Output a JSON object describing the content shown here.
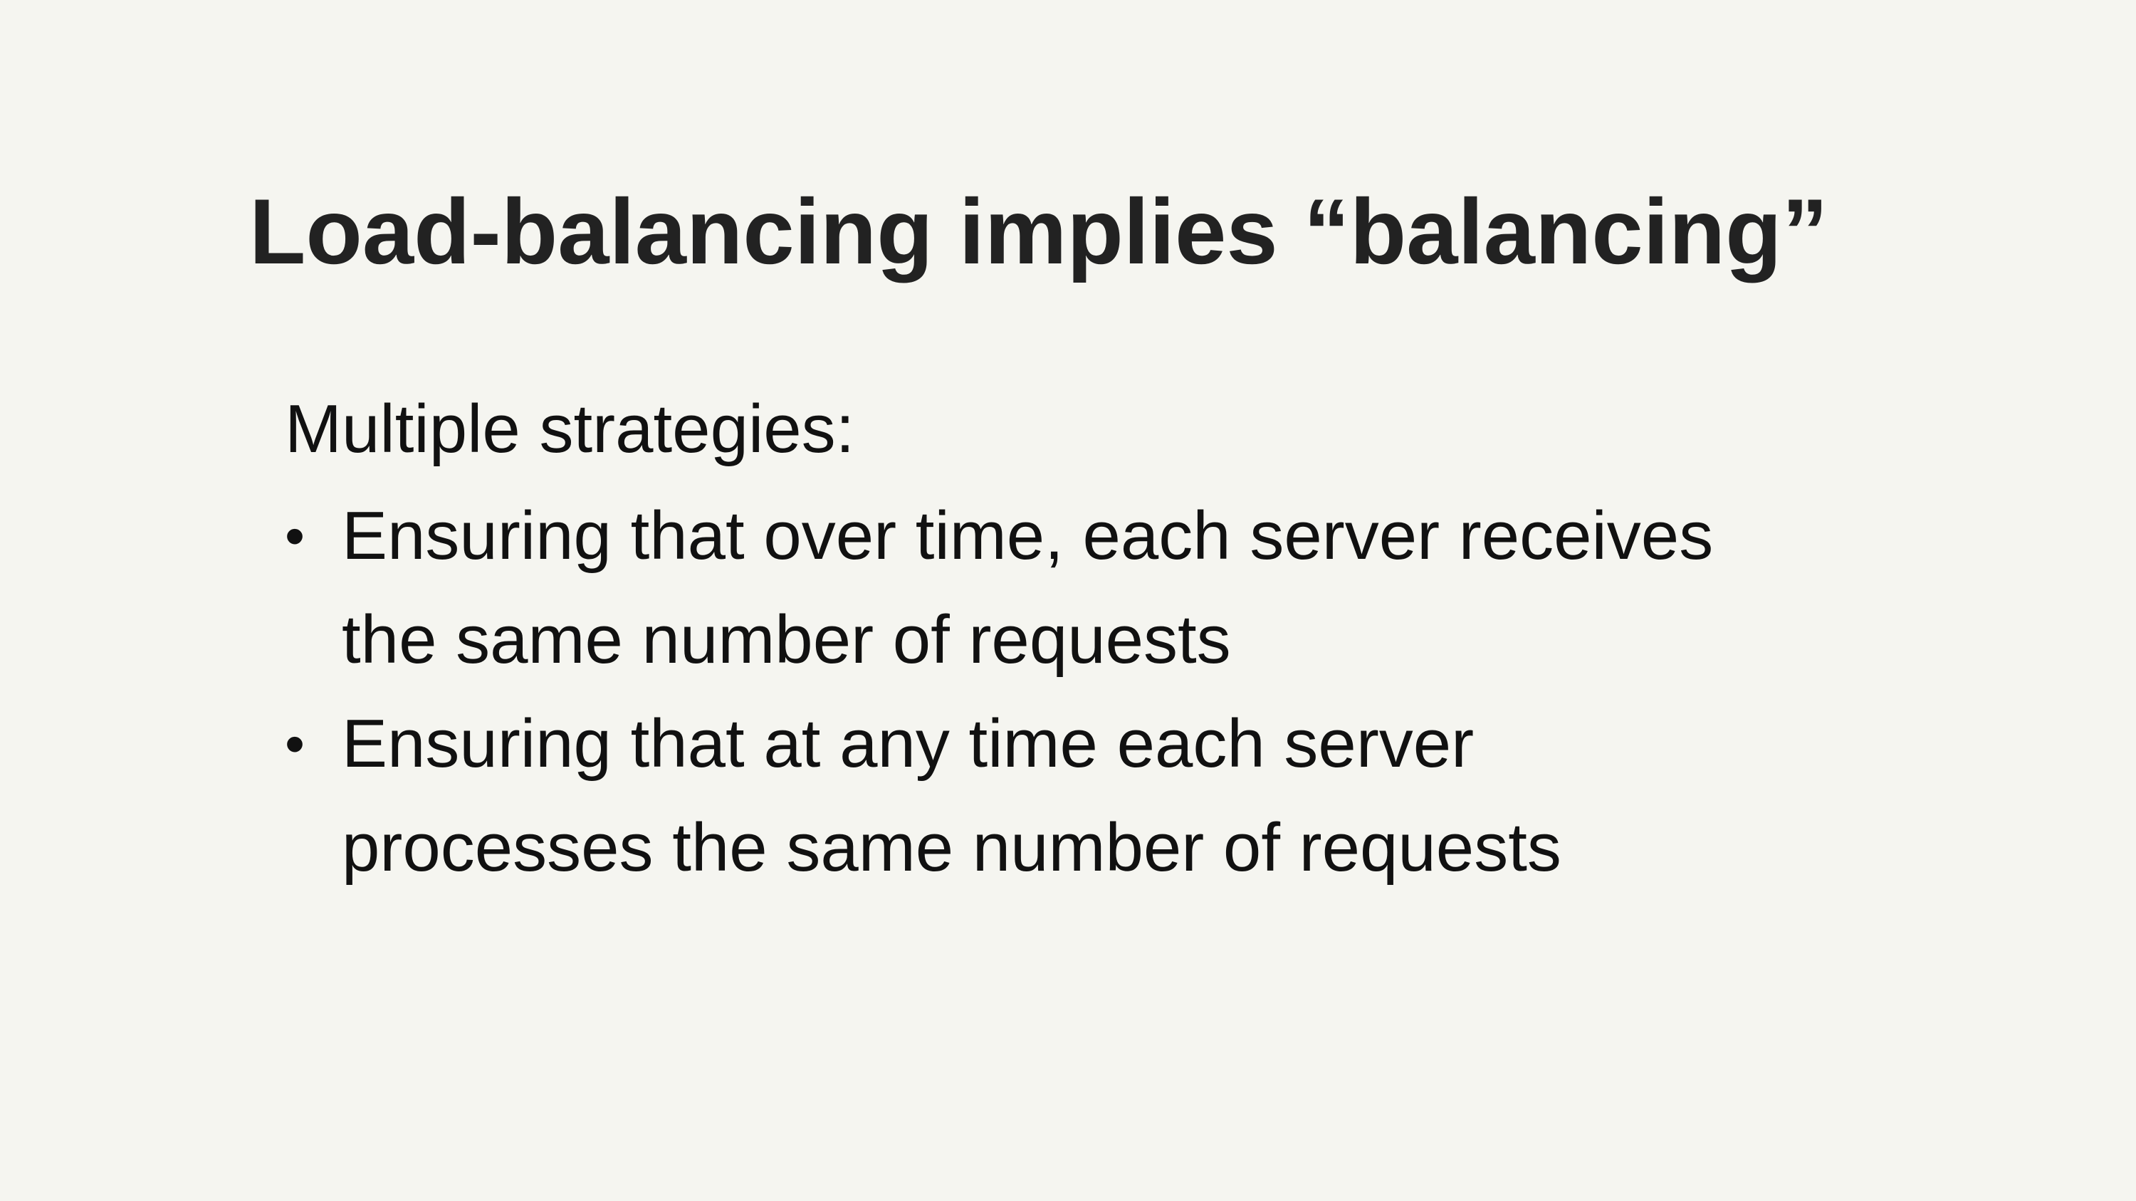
{
  "slide": {
    "title": "Load-balancing implies “balancing”",
    "intro": "Multiple strategies:",
    "bullet_symbol": "•",
    "bullets": [
      {
        "line1": "Ensuring that over time, each server receives",
        "line2": "the same number of requests"
      },
      {
        "line1": "Ensuring that at any time each server",
        "line2": "processes the same number of requests"
      }
    ]
  }
}
